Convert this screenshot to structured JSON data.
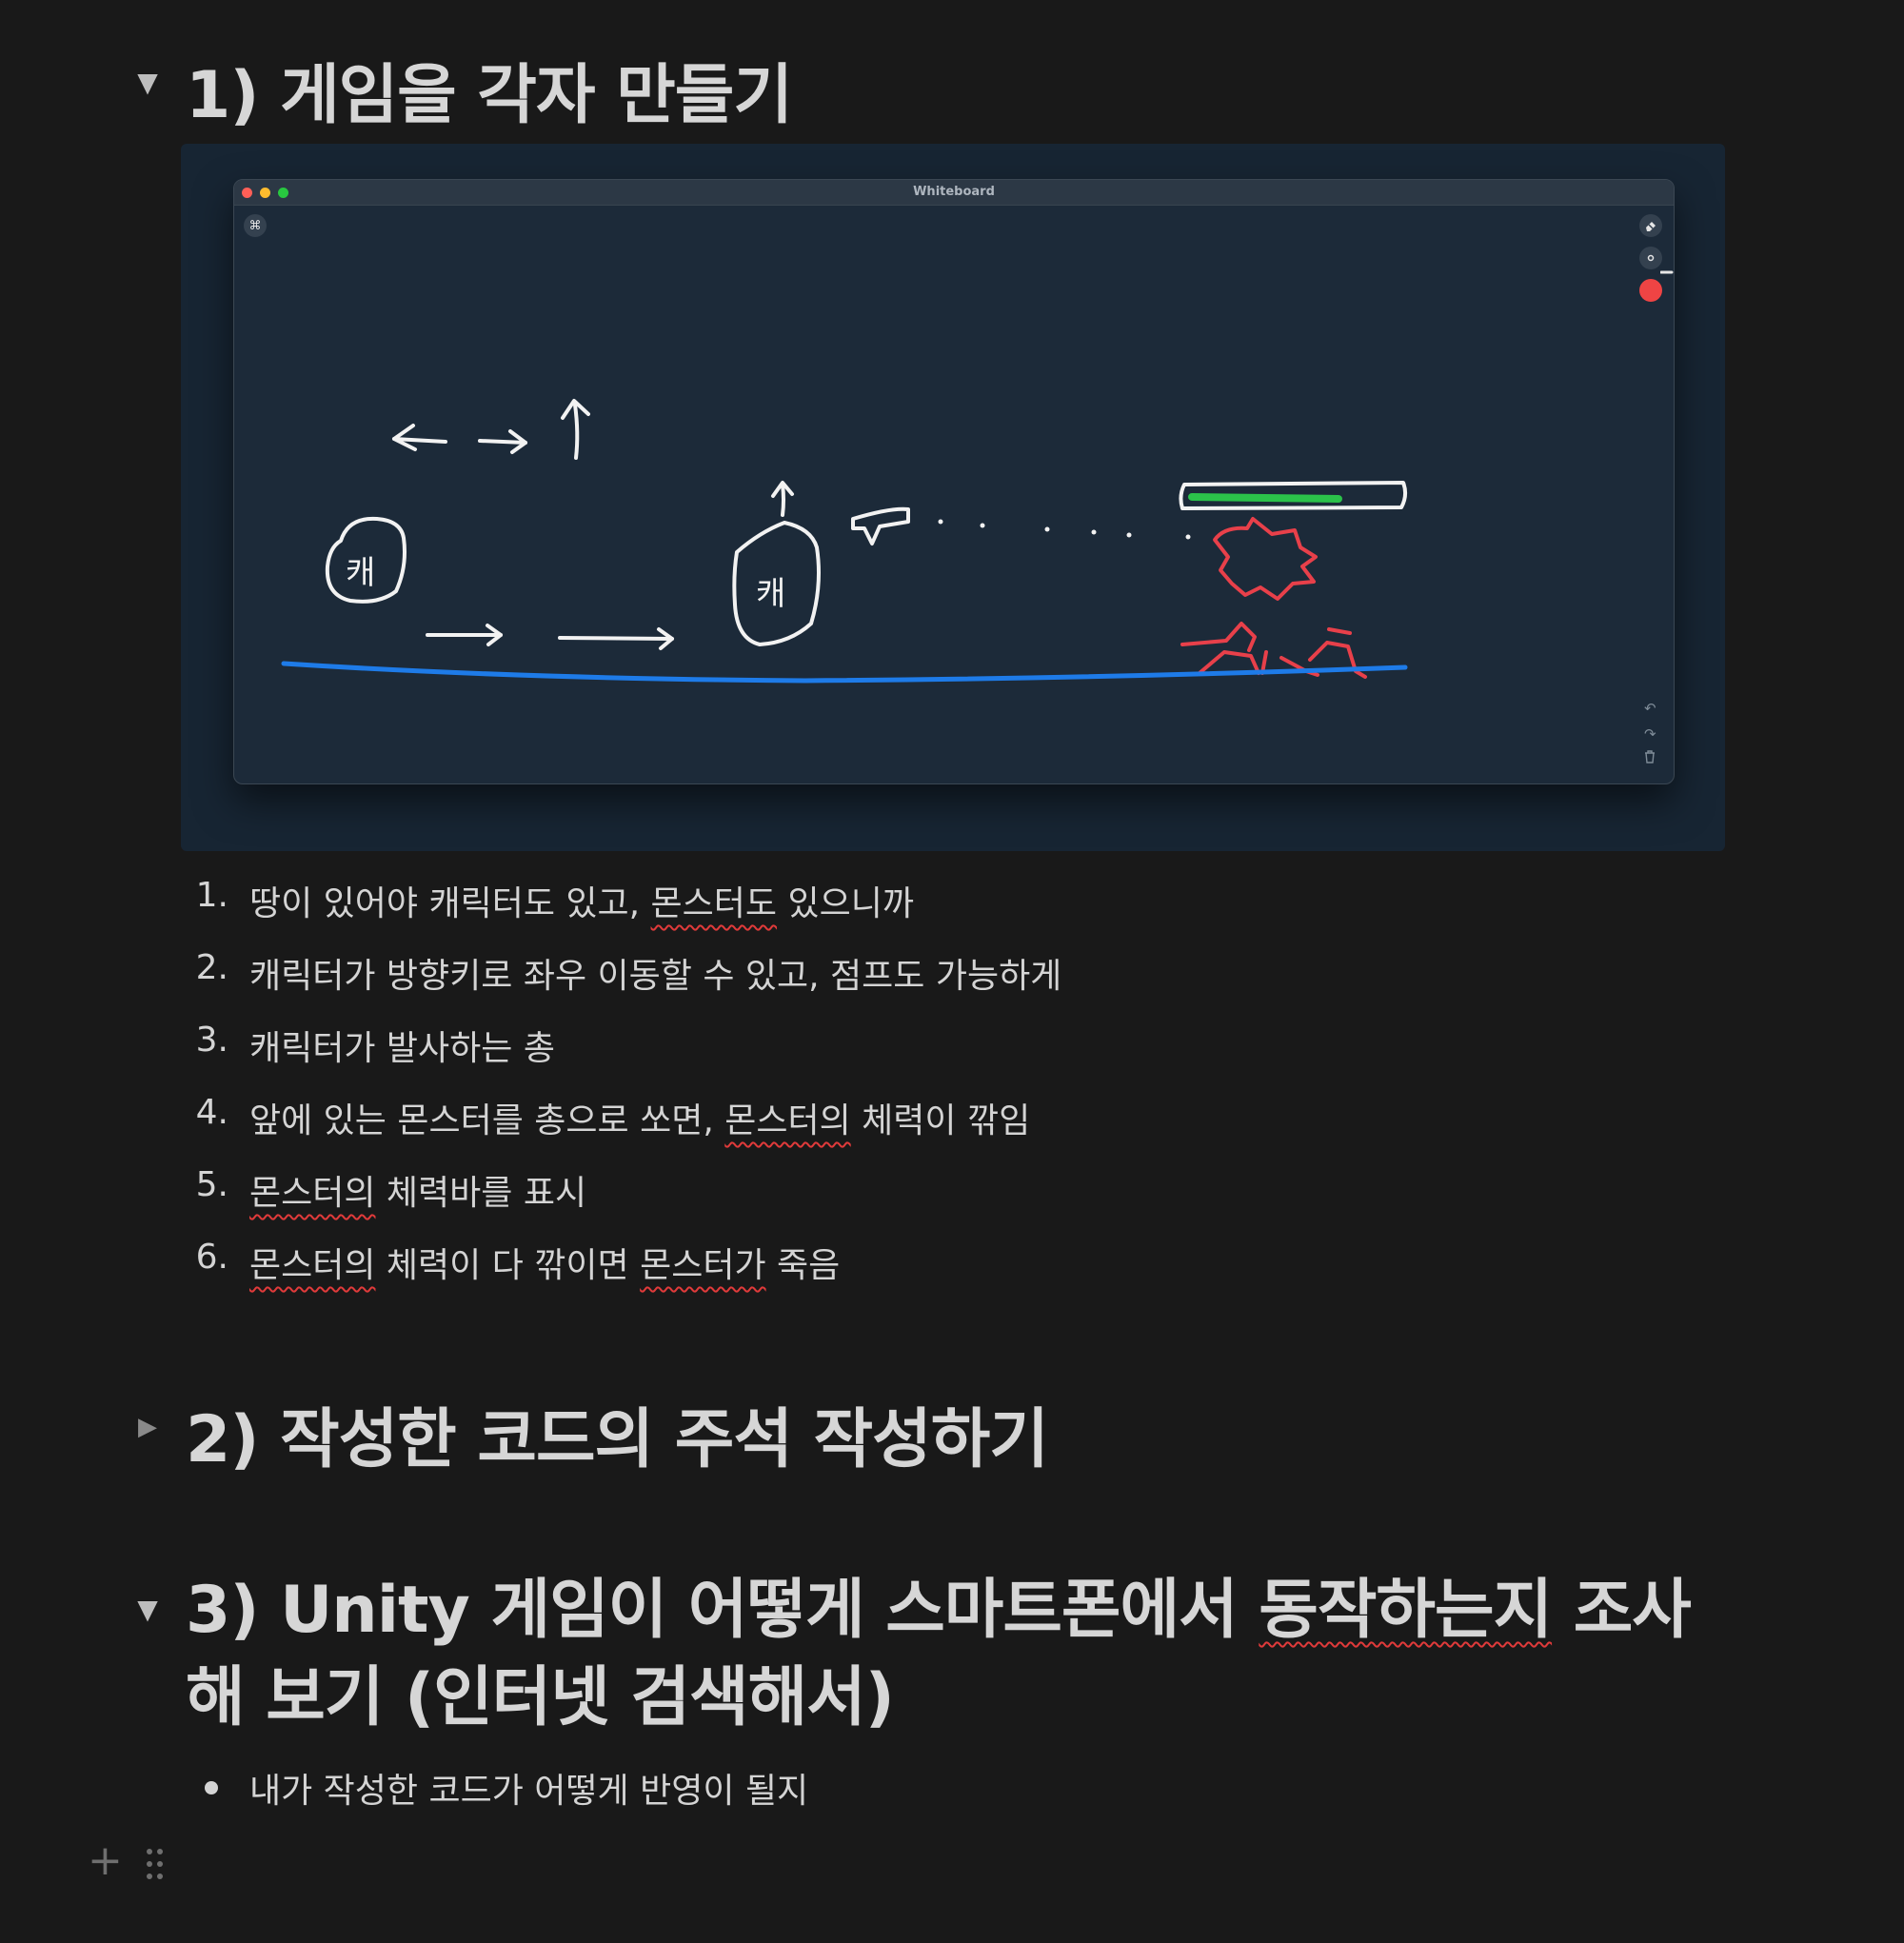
{
  "sections": [
    {
      "number_title": "1) 게임을 각자 만들기",
      "state": "expanded"
    },
    {
      "number_title": "2) 작성한 코드의 주석 작성하기",
      "state": "collapsed"
    },
    {
      "number_title_part1": "3) Unity 게임이 어떻게 스마트폰에서 ",
      "number_title_flagged": "동작하는지",
      "number_title_part2": " 조사해 보기 (인터넷 검색해서)",
      "state": "expanded"
    }
  ],
  "toggle_icons": {
    "expanded": "▼",
    "collapsed": "▶"
  },
  "whiteboard": {
    "window_title": "Whiteboard",
    "command_icon": "⌘",
    "tools": {
      "eraser": "eraser-icon",
      "brush": "brush-size-icon",
      "color": "#ef4444"
    },
    "action_icons": {
      "undo": "↶",
      "redo": "↷",
      "trash": "🗑"
    },
    "sketch_labels": [
      "캐",
      "캐"
    ],
    "colors": {
      "ground": "#1e7be8",
      "monster": "#e8404a",
      "health": "#2bc24a",
      "chalk": "#f2f2f2"
    }
  },
  "list": [
    {
      "num": "1.",
      "pre": "땅이 있어야 캐릭터도 있고, ",
      "flag": "몬스터도",
      "post": " 있으니까"
    },
    {
      "num": "2.",
      "pre": "캐릭터가 방향키로 좌우 이동할 수 있고, 점프도 가능하게",
      "flag": "",
      "post": ""
    },
    {
      "num": "3.",
      "pre": "캐릭터가 발사하는 총",
      "flag": "",
      "post": ""
    },
    {
      "num": "4.",
      "pre": "앞에 있는 몬스터를 총으로 쏘면, ",
      "flag": "몬스터의",
      "post": " 체력이 깎임"
    },
    {
      "num": "5.",
      "pre": "",
      "flag": "몬스터의",
      "post": " 체력바를 표시"
    },
    {
      "num": "6.",
      "pre": "",
      "flag": "몬스터의",
      "post": " 체력이 다 깎이면 ",
      "flag2": "몬스터가",
      "post2": " 죽음"
    }
  ],
  "bullet_item": "내가 작성한 코드가 어떻게 반영이 될지",
  "editor": {
    "add_icon": "+",
    "drag_icon": "drag-handle-icon"
  }
}
